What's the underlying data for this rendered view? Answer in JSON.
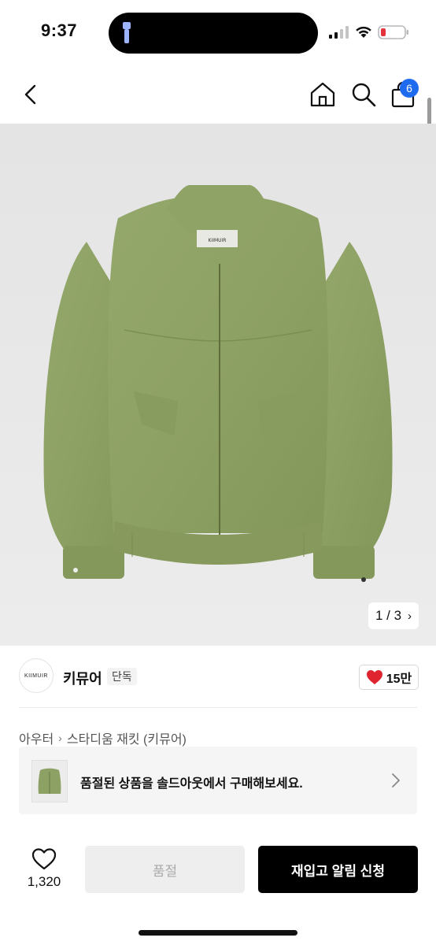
{
  "status_bar": {
    "time": "9:37",
    "icons": [
      "flashlight-icon",
      "signal-icon",
      "wifi-icon",
      "battery-icon"
    ]
  },
  "nav": {
    "cart_badge": "6",
    "icons": [
      "back-chevron-icon",
      "home-icon",
      "search-icon",
      "cart-icon"
    ]
  },
  "product": {
    "image_counter": "1 / 3",
    "image_label": "KIIMUIR",
    "colors": {
      "jacket": "#8fa266",
      "background": "#e8e8e8"
    }
  },
  "brand": {
    "logo_text": "KIIMUIR",
    "name": "키뮤어",
    "tag": "단독",
    "likes": "15만",
    "like_color": "#e0242f"
  },
  "breadcrumb": {
    "category": "아우터",
    "product_name": "스타디움 재킷 (키뮤어)"
  },
  "soldout_banner": {
    "text": "품절된 상품을 솔드아웃에서 구매해보세요."
  },
  "bottom_bar": {
    "wish_count": "1,320",
    "soldout_label": "품절",
    "restock_label": "재입고 알림 신청"
  }
}
